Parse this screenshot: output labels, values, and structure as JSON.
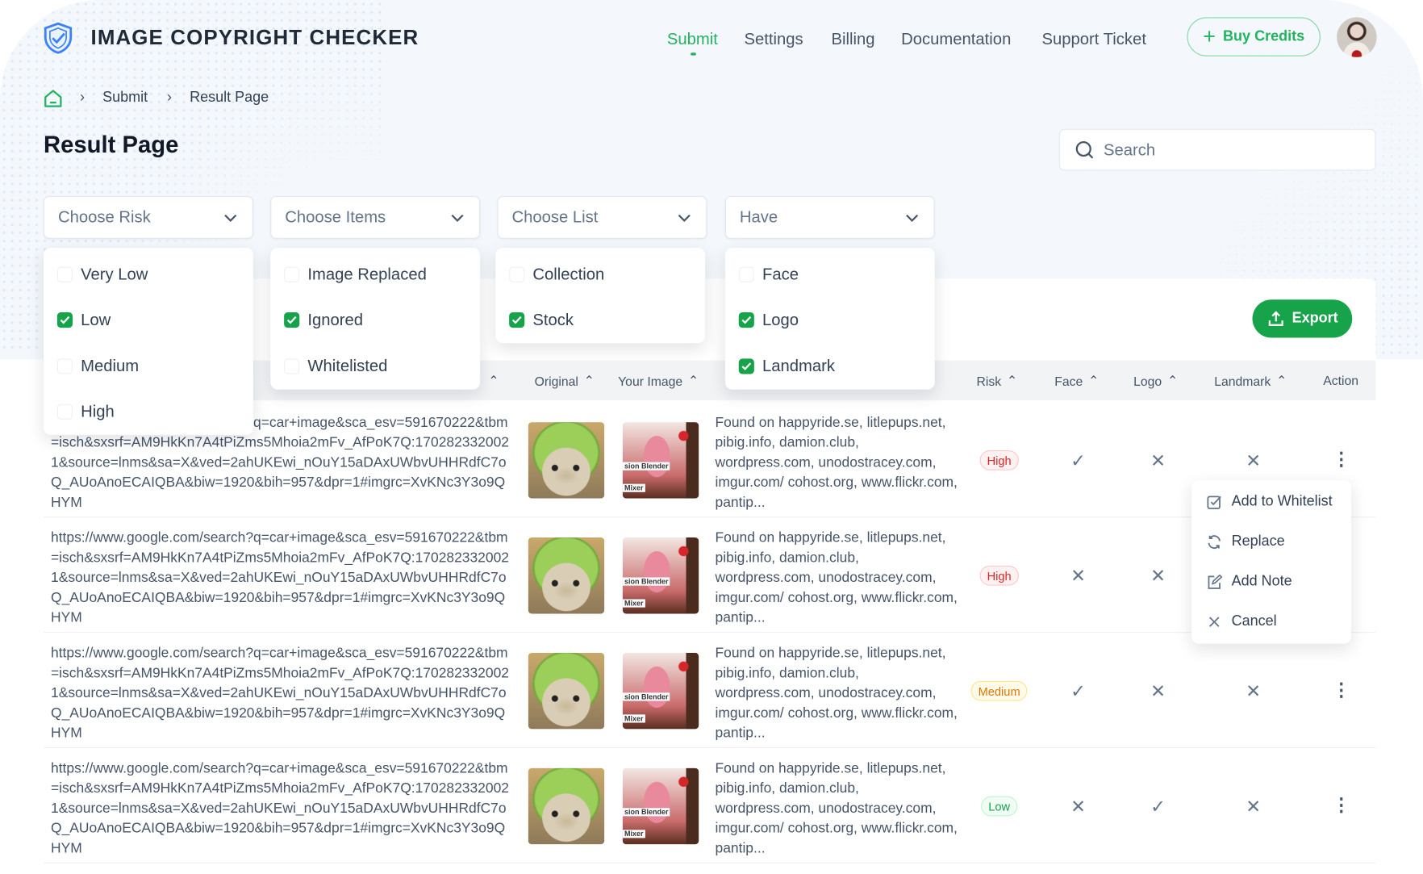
{
  "brand": {
    "name": "IMAGE COPYRIGHT CHECKER",
    "accent": "#22b35e",
    "logo_color": "#3b82f6"
  },
  "nav": {
    "items": [
      {
        "label": "Submit",
        "active": true
      },
      {
        "label": "Settings"
      },
      {
        "label": "Billing"
      },
      {
        "label": "Documentation"
      },
      {
        "label": "Support Ticket"
      }
    ],
    "buy_credits": "Buy Credits"
  },
  "breadcrumb": {
    "items": [
      "Submit",
      "Result Page"
    ]
  },
  "page": {
    "title": "Result Page"
  },
  "search": {
    "placeholder": "Search"
  },
  "filters": [
    {
      "label": "Choose Risk",
      "options": [
        {
          "label": "Very Low",
          "checked": false
        },
        {
          "label": "Low",
          "checked": true
        },
        {
          "label": "Medium",
          "checked": false
        },
        {
          "label": "High",
          "checked": false
        }
      ]
    },
    {
      "label": "Choose Items",
      "options": [
        {
          "label": "Image Replaced",
          "checked": false
        },
        {
          "label": "Ignored",
          "checked": true
        },
        {
          "label": "Whitelisted",
          "checked": false
        }
      ]
    },
    {
      "label": "Choose List",
      "options": [
        {
          "label": "Collection",
          "checked": false
        },
        {
          "label": "Stock",
          "checked": true
        }
      ]
    },
    {
      "label": "Have",
      "options": [
        {
          "label": "Face",
          "checked": false
        },
        {
          "label": "Logo",
          "checked": true
        },
        {
          "label": "Landmark",
          "checked": true
        }
      ]
    }
  ],
  "toolbar": {
    "export": "Export"
  },
  "table": {
    "columns": {
      "original": "Original",
      "your_image": "Your Image",
      "risk": "Risk",
      "face": "Face",
      "logo": "Logo",
      "landmark": "Landmark",
      "action": "Action"
    },
    "rows": [
      {
        "url": "https://www.google.com/search?q=car+image&sca_esv=591670222&tbm=isch&sxsrf=AM9HkKn7A4tPiZms5Mhoia2mFv_AfPoK7Q:1702823320021&source=lnms&sa=X&ved=2ahUKEwi_nOuY15aDAxUWbvUHHRdfC7oQ_AUoAnoECAIQBA&biw=1920&bih=957&dpr=1#imgrc=XvKNc3Y3o9QHYM",
        "found": "Found on happyride.se, litlepups.net, pibig.info, damion.club, wordpress.com, unodostracey.com, imgur.com/ cohost.org, www.flickr.com, pantip...",
        "risk": "High",
        "face": "check",
        "logo": "x",
        "landmark": "x"
      },
      {
        "url": "https://www.google.com/search?q=car+image&sca_esv=591670222&tbm=isch&sxsrf=AM9HkKn7A4tPiZms5Mhoia2mFv_AfPoK7Q:1702823320021&source=lnms&sa=X&ved=2ahUKEwi_nOuY15aDAxUWbvUHHRdfC7oQ_AUoAnoECAIQBA&biw=1920&bih=957&dpr=1#imgrc=XvKNc3Y3o9QHYM",
        "found": "Found on happyride.se, litlepups.net, pibig.info, damion.club, wordpress.com, unodostracey.com, imgur.com/ cohost.org, www.flickr.com, pantip...",
        "risk": "High",
        "face": "x",
        "logo": "x"
      },
      {
        "url": "https://www.google.com/search?q=car+image&sca_esv=591670222&tbm=isch&sxsrf=AM9HkKn7A4tPiZms5Mhoia2mFv_AfPoK7Q:1702823320021&source=lnms&sa=X&ved=2ahUKEwi_nOuY15aDAxUWbvUHHRdfC7oQ_AUoAnoECAIQBA&biw=1920&bih=957&dpr=1#imgrc=XvKNc3Y3o9QHYM",
        "found": "Found on happyride.se, litlepups.net, pibig.info, damion.club, wordpress.com, unodostracey.com, imgur.com/ cohost.org, www.flickr.com, pantip...",
        "risk": "Medium",
        "face": "check",
        "logo": "x",
        "landmark": "x"
      },
      {
        "url": "https://www.google.com/search?q=car+image&sca_esv=591670222&tbm=isch&sxsrf=AM9HkKn7A4tPiZms5Mhoia2mFv_AfPoK7Q:1702823320021&source=lnms&sa=X&ved=2ahUKEwi_nOuY15aDAxUWbvUHHRdfC7oQ_AUoAnoECAIQBA&biw=1920&bih=957&dpr=1#imgrc=XvKNc3Y3o9QHYM",
        "found": "Found on happyride.se, litlepups.net, pibig.info, damion.club, wordpress.com, unodostracey.com, imgur.com/ cohost.org, www.flickr.com, pantip...",
        "risk": "Low",
        "face": "x",
        "logo": "check",
        "landmark": "x"
      }
    ],
    "thumb_caption": [
      "sion Blender",
      "Mixer"
    ]
  },
  "action_menu": {
    "items": [
      {
        "label": "Add to Whitelist",
        "icon": "checkbox-edit-icon"
      },
      {
        "label": "Replace",
        "icon": "refresh-icon"
      },
      {
        "label": "Add Note",
        "icon": "edit-note-icon"
      },
      {
        "label": "Cancel",
        "icon": "close-icon"
      }
    ]
  }
}
